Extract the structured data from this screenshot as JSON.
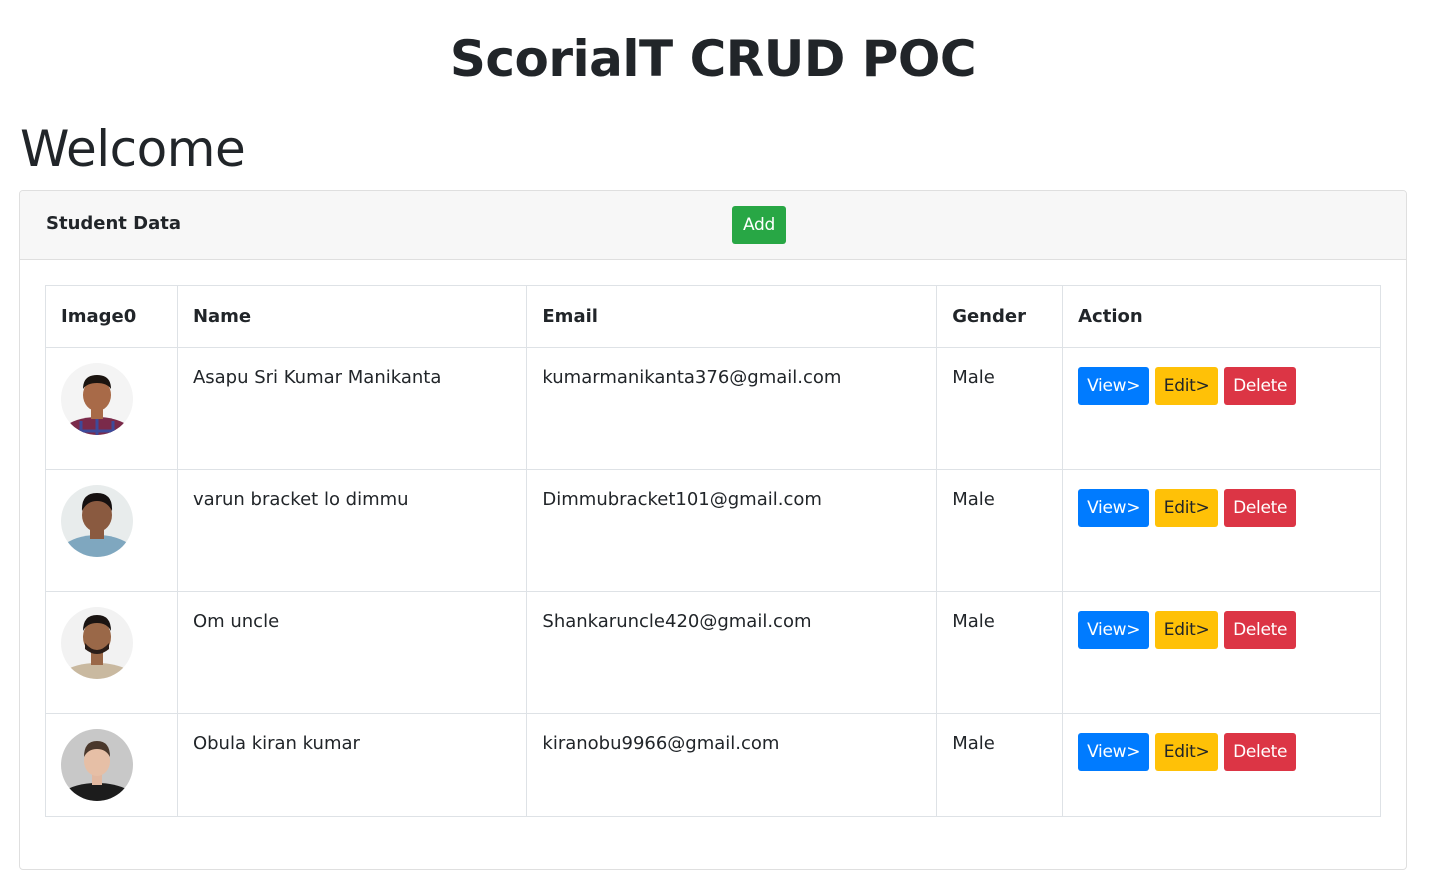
{
  "app_title": "ScorialT CRUD POC",
  "welcome": "Welcome",
  "card": {
    "title": "Student Data",
    "add_label": "Add"
  },
  "table": {
    "headers": [
      "Image0",
      "Name",
      "Email",
      "Gender",
      "Action"
    ],
    "rows": [
      {
        "name": "Asapu Sri Kumar Manikanta",
        "email": "kumarmanikanta376@gmail.com",
        "gender": "Male"
      },
      {
        "name": "varun bracket lo dimmu",
        "email": "Dimmubracket101@gmail.com",
        "gender": "Male"
      },
      {
        "name": "Om uncle",
        "email": "Shankaruncle420@gmail.com",
        "gender": "Male"
      },
      {
        "name": "Obula kiran kumar",
        "email": "kiranobu9966@gmail.com",
        "gender": "Male"
      }
    ],
    "actions": {
      "view": "View>",
      "edit": "Edit>",
      "delete": "Delete"
    }
  },
  "colors": {
    "add": "#28a745",
    "view": "#007bff",
    "edit": "#ffc107",
    "delete": "#dc3545"
  }
}
